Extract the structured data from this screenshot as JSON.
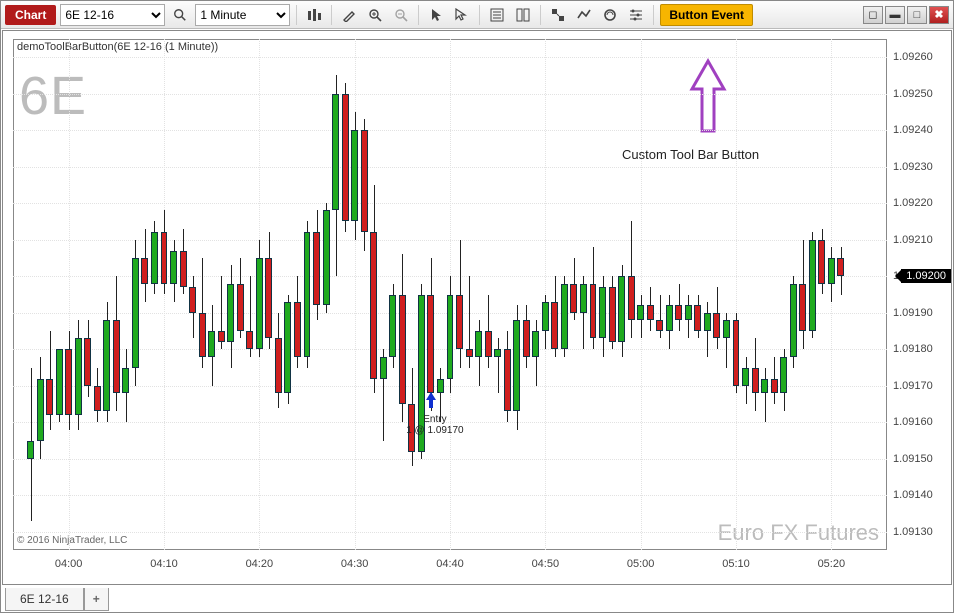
{
  "toolbar": {
    "tab_label": "Chart",
    "instrument_options": [
      "6E 12-16"
    ],
    "instrument_selected": "6E 12-16",
    "interval_options": [
      "1 Minute"
    ],
    "interval_selected": "1 Minute",
    "custom_button_label": "Button Event"
  },
  "chart": {
    "title": "demoToolBarButton(6E 12-16 (1 Minute))",
    "symbol_big": "6E",
    "instrument_name": "Euro FX Futures",
    "copyright": "© 2016 NinjaTrader, LLC",
    "callout_text": "Custom Tool Bar Button",
    "entry_label_line1": "Entry",
    "entry_label_line2": "1 @ 1.09170",
    "current_price_tag": "1.09200"
  },
  "tabs": {
    "doc_tab_label": "6E 12-16",
    "add_tab_label": "+"
  },
  "chart_data": {
    "type": "candlestick",
    "title": "demoToolBarButton(6E 12-16 (1 Minute))",
    "xlabel": "",
    "ylabel": "",
    "ylim": [
      1.0913,
      1.0926
    ],
    "y_ticks": [
      1.0913,
      1.0914,
      1.0915,
      1.0916,
      1.0917,
      1.0918,
      1.0919,
      1.092,
      1.0921,
      1.0922,
      1.0923,
      1.0924,
      1.0925,
      1.0926
    ],
    "x_ticks": [
      "04:00",
      "04:10",
      "04:20",
      "04:30",
      "04:40",
      "04:50",
      "05:00",
      "05:10",
      "05:20"
    ],
    "x_range": [
      "03:55",
      "05:25"
    ],
    "current_price": 1.092,
    "annotation": {
      "time": "04:38",
      "text": "Entry 1 @ 1.09170",
      "price": 1.0917,
      "marker": "arrow-up",
      "color": "#1030d0"
    },
    "series": [
      {
        "name": "6E 12-16",
        "candles": [
          {
            "t": "03:56",
            "o": 1.0915,
            "h": 1.09175,
            "l": 1.09133,
            "c": 1.09155
          },
          {
            "t": "03:57",
            "o": 1.09155,
            "h": 1.09178,
            "l": 1.0915,
            "c": 1.09172
          },
          {
            "t": "03:58",
            "o": 1.09172,
            "h": 1.09185,
            "l": 1.09158,
            "c": 1.09162
          },
          {
            "t": "03:59",
            "o": 1.09162,
            "h": 1.0918,
            "l": 1.0916,
            "c": 1.0918
          },
          {
            "t": "04:00",
            "o": 1.0918,
            "h": 1.09185,
            "l": 1.09158,
            "c": 1.09162
          },
          {
            "t": "04:01",
            "o": 1.09162,
            "h": 1.09188,
            "l": 1.09158,
            "c": 1.09183
          },
          {
            "t": "04:02",
            "o": 1.09183,
            "h": 1.09188,
            "l": 1.09167,
            "c": 1.0917
          },
          {
            "t": "04:03",
            "o": 1.0917,
            "h": 1.09175,
            "l": 1.0916,
            "c": 1.09163
          },
          {
            "t": "04:04",
            "o": 1.09163,
            "h": 1.09193,
            "l": 1.0916,
            "c": 1.09188
          },
          {
            "t": "04:05",
            "o": 1.09188,
            "h": 1.092,
            "l": 1.09163,
            "c": 1.09168
          },
          {
            "t": "04:06",
            "o": 1.09168,
            "h": 1.0918,
            "l": 1.0916,
            "c": 1.09175
          },
          {
            "t": "04:07",
            "o": 1.09175,
            "h": 1.0921,
            "l": 1.0917,
            "c": 1.09205
          },
          {
            "t": "04:08",
            "o": 1.09205,
            "h": 1.09213,
            "l": 1.09193,
            "c": 1.09198
          },
          {
            "t": "04:09",
            "o": 1.09198,
            "h": 1.09215,
            "l": 1.09195,
            "c": 1.09212
          },
          {
            "t": "04:10",
            "o": 1.09212,
            "h": 1.09218,
            "l": 1.09195,
            "c": 1.09198
          },
          {
            "t": "04:11",
            "o": 1.09198,
            "h": 1.0921,
            "l": 1.09193,
            "c": 1.09207
          },
          {
            "t": "04:12",
            "o": 1.09207,
            "h": 1.09213,
            "l": 1.09195,
            "c": 1.09197
          },
          {
            "t": "04:13",
            "o": 1.09197,
            "h": 1.092,
            "l": 1.09183,
            "c": 1.0919
          },
          {
            "t": "04:14",
            "o": 1.0919,
            "h": 1.09205,
            "l": 1.09175,
            "c": 1.09178
          },
          {
            "t": "04:15",
            "o": 1.09178,
            "h": 1.09192,
            "l": 1.0917,
            "c": 1.09185
          },
          {
            "t": "04:16",
            "o": 1.09185,
            "h": 1.092,
            "l": 1.0918,
            "c": 1.09182
          },
          {
            "t": "04:17",
            "o": 1.09182,
            "h": 1.09203,
            "l": 1.09175,
            "c": 1.09198
          },
          {
            "t": "04:18",
            "o": 1.09198,
            "h": 1.09205,
            "l": 1.09183,
            "c": 1.09185
          },
          {
            "t": "04:19",
            "o": 1.09185,
            "h": 1.092,
            "l": 1.09178,
            "c": 1.0918
          },
          {
            "t": "04:20",
            "o": 1.0918,
            "h": 1.0921,
            "l": 1.09178,
            "c": 1.09205
          },
          {
            "t": "04:21",
            "o": 1.09205,
            "h": 1.09212,
            "l": 1.0918,
            "c": 1.09183
          },
          {
            "t": "04:22",
            "o": 1.09183,
            "h": 1.0919,
            "l": 1.09164,
            "c": 1.09168
          },
          {
            "t": "04:23",
            "o": 1.09168,
            "h": 1.09195,
            "l": 1.09165,
            "c": 1.09193
          },
          {
            "t": "04:24",
            "o": 1.09193,
            "h": 1.092,
            "l": 1.09175,
            "c": 1.09178
          },
          {
            "t": "04:25",
            "o": 1.09178,
            "h": 1.09215,
            "l": 1.09175,
            "c": 1.09212
          },
          {
            "t": "04:26",
            "o": 1.09212,
            "h": 1.09218,
            "l": 1.09188,
            "c": 1.09192
          },
          {
            "t": "04:27",
            "o": 1.09192,
            "h": 1.0922,
            "l": 1.0919,
            "c": 1.09218
          },
          {
            "t": "04:28",
            "o": 1.09218,
            "h": 1.09255,
            "l": 1.092,
            "c": 1.0925
          },
          {
            "t": "04:29",
            "o": 1.0925,
            "h": 1.09253,
            "l": 1.09212,
            "c": 1.09215
          },
          {
            "t": "04:30",
            "o": 1.09215,
            "h": 1.09245,
            "l": 1.0921,
            "c": 1.0924
          },
          {
            "t": "04:31",
            "o": 1.0924,
            "h": 1.09243,
            "l": 1.09207,
            "c": 1.09212
          },
          {
            "t": "04:32",
            "o": 1.09212,
            "h": 1.09225,
            "l": 1.09168,
            "c": 1.09172
          },
          {
            "t": "04:33",
            "o": 1.09172,
            "h": 1.0918,
            "l": 1.09155,
            "c": 1.09178
          },
          {
            "t": "04:34",
            "o": 1.09178,
            "h": 1.09198,
            "l": 1.09175,
            "c": 1.09195
          },
          {
            "t": "04:35",
            "o": 1.09195,
            "h": 1.09206,
            "l": 1.0916,
            "c": 1.09165
          },
          {
            "t": "04:36",
            "o": 1.09165,
            "h": 1.09175,
            "l": 1.09148,
            "c": 1.09152
          },
          {
            "t": "04:37",
            "o": 1.09152,
            "h": 1.09198,
            "l": 1.0915,
            "c": 1.09195
          },
          {
            "t": "04:38",
            "o": 1.09195,
            "h": 1.09205,
            "l": 1.09163,
            "c": 1.09168
          },
          {
            "t": "04:39",
            "o": 1.09168,
            "h": 1.09175,
            "l": 1.0916,
            "c": 1.09172
          },
          {
            "t": "04:40",
            "o": 1.09172,
            "h": 1.092,
            "l": 1.09168,
            "c": 1.09195
          },
          {
            "t": "04:41",
            "o": 1.09195,
            "h": 1.0921,
            "l": 1.09175,
            "c": 1.0918
          },
          {
            "t": "04:42",
            "o": 1.0918,
            "h": 1.092,
            "l": 1.09175,
            "c": 1.09178
          },
          {
            "t": "04:43",
            "o": 1.09178,
            "h": 1.09188,
            "l": 1.0917,
            "c": 1.09185
          },
          {
            "t": "04:44",
            "o": 1.09185,
            "h": 1.09195,
            "l": 1.09175,
            "c": 1.09178
          },
          {
            "t": "04:45",
            "o": 1.09178,
            "h": 1.09183,
            "l": 1.09168,
            "c": 1.0918
          },
          {
            "t": "04:46",
            "o": 1.0918,
            "h": 1.09185,
            "l": 1.0916,
            "c": 1.09163
          },
          {
            "t": "04:47",
            "o": 1.09163,
            "h": 1.09192,
            "l": 1.09158,
            "c": 1.09188
          },
          {
            "t": "04:48",
            "o": 1.09188,
            "h": 1.09192,
            "l": 1.09175,
            "c": 1.09178
          },
          {
            "t": "04:49",
            "o": 1.09178,
            "h": 1.09188,
            "l": 1.0917,
            "c": 1.09185
          },
          {
            "t": "04:50",
            "o": 1.09185,
            "h": 1.09195,
            "l": 1.0918,
            "c": 1.09193
          },
          {
            "t": "04:51",
            "o": 1.09193,
            "h": 1.092,
            "l": 1.09178,
            "c": 1.0918
          },
          {
            "t": "04:52",
            "o": 1.0918,
            "h": 1.092,
            "l": 1.09178,
            "c": 1.09198
          },
          {
            "t": "04:53",
            "o": 1.09198,
            "h": 1.09205,
            "l": 1.09188,
            "c": 1.0919
          },
          {
            "t": "04:54",
            "o": 1.0919,
            "h": 1.092,
            "l": 1.0918,
            "c": 1.09198
          },
          {
            "t": "04:55",
            "o": 1.09198,
            "h": 1.09208,
            "l": 1.0918,
            "c": 1.09183
          },
          {
            "t": "04:56",
            "o": 1.09183,
            "h": 1.092,
            "l": 1.09178,
            "c": 1.09197
          },
          {
            "t": "04:57",
            "o": 1.09197,
            "h": 1.092,
            "l": 1.0918,
            "c": 1.09182
          },
          {
            "t": "04:58",
            "o": 1.09182,
            "h": 1.09203,
            "l": 1.09178,
            "c": 1.092
          },
          {
            "t": "04:59",
            "o": 1.092,
            "h": 1.09215,
            "l": 1.09183,
            "c": 1.09188
          },
          {
            "t": "05:00",
            "o": 1.09188,
            "h": 1.09195,
            "l": 1.09183,
            "c": 1.09192
          },
          {
            "t": "05:01",
            "o": 1.09192,
            "h": 1.09197,
            "l": 1.09185,
            "c": 1.09188
          },
          {
            "t": "05:02",
            "o": 1.09188,
            "h": 1.09195,
            "l": 1.09183,
            "c": 1.09185
          },
          {
            "t": "05:03",
            "o": 1.09185,
            "h": 1.09195,
            "l": 1.0918,
            "c": 1.09192
          },
          {
            "t": "05:04",
            "o": 1.09192,
            "h": 1.09198,
            "l": 1.09185,
            "c": 1.09188
          },
          {
            "t": "05:05",
            "o": 1.09188,
            "h": 1.09195,
            "l": 1.09183,
            "c": 1.09192
          },
          {
            "t": "05:06",
            "o": 1.09192,
            "h": 1.09195,
            "l": 1.09183,
            "c": 1.09185
          },
          {
            "t": "05:07",
            "o": 1.09185,
            "h": 1.09193,
            "l": 1.09178,
            "c": 1.0919
          },
          {
            "t": "05:08",
            "o": 1.0919,
            "h": 1.09197,
            "l": 1.0918,
            "c": 1.09183
          },
          {
            "t": "05:09",
            "o": 1.09183,
            "h": 1.0919,
            "l": 1.09175,
            "c": 1.09188
          },
          {
            "t": "05:10",
            "o": 1.09188,
            "h": 1.0919,
            "l": 1.09168,
            "c": 1.0917
          },
          {
            "t": "05:11",
            "o": 1.0917,
            "h": 1.09178,
            "l": 1.09165,
            "c": 1.09175
          },
          {
            "t": "05:12",
            "o": 1.09175,
            "h": 1.09183,
            "l": 1.09163,
            "c": 1.09168
          },
          {
            "t": "05:13",
            "o": 1.09168,
            "h": 1.09175,
            "l": 1.0916,
            "c": 1.09172
          },
          {
            "t": "05:14",
            "o": 1.09172,
            "h": 1.09178,
            "l": 1.09165,
            "c": 1.09168
          },
          {
            "t": "05:15",
            "o": 1.09168,
            "h": 1.0918,
            "l": 1.09163,
            "c": 1.09178
          },
          {
            "t": "05:16",
            "o": 1.09178,
            "h": 1.092,
            "l": 1.09175,
            "c": 1.09198
          },
          {
            "t": "05:17",
            "o": 1.09198,
            "h": 1.0921,
            "l": 1.0918,
            "c": 1.09185
          },
          {
            "t": "05:18",
            "o": 1.09185,
            "h": 1.09212,
            "l": 1.09183,
            "c": 1.0921
          },
          {
            "t": "05:19",
            "o": 1.0921,
            "h": 1.09213,
            "l": 1.09195,
            "c": 1.09198
          },
          {
            "t": "05:20",
            "o": 1.09198,
            "h": 1.09208,
            "l": 1.09193,
            "c": 1.09205
          },
          {
            "t": "05:21",
            "o": 1.09205,
            "h": 1.09208,
            "l": 1.09195,
            "c": 1.092
          }
        ]
      }
    ]
  }
}
